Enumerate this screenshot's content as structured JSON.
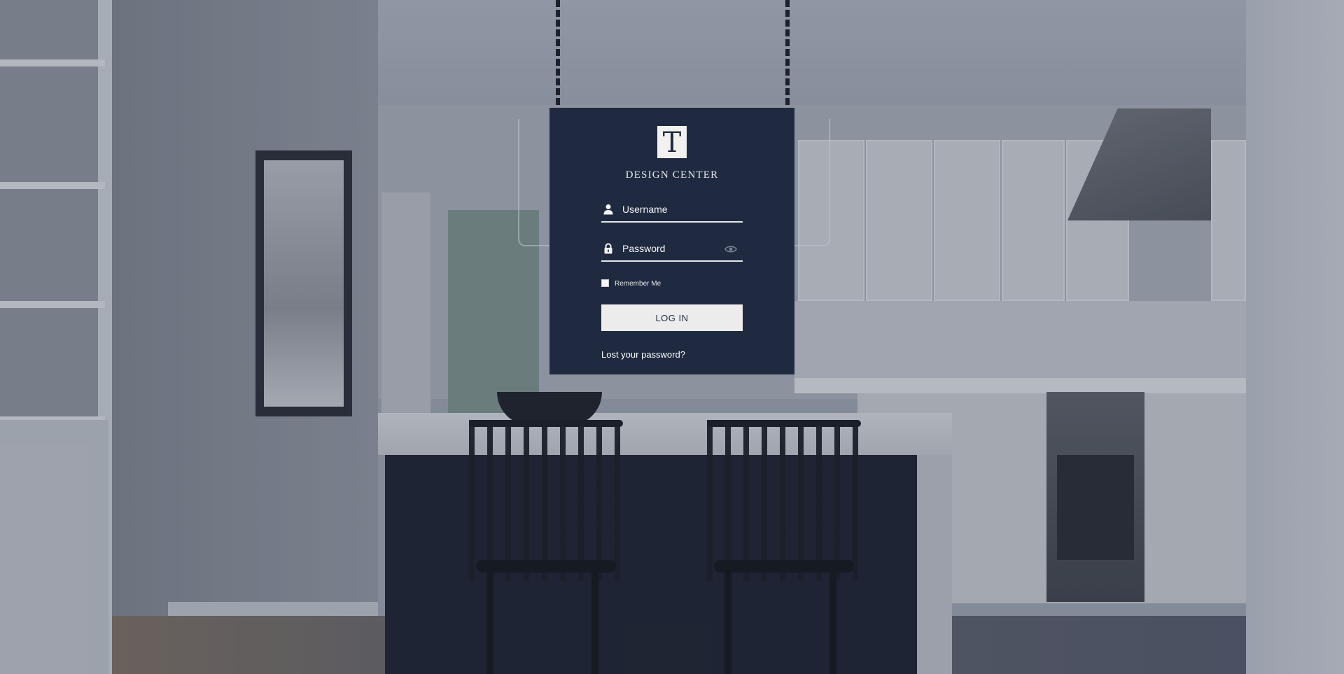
{
  "brand": {
    "logo_letter": "T",
    "name": "DESIGN CENTER"
  },
  "login": {
    "username_placeholder": "Username",
    "password_placeholder": "Password",
    "remember_label": "Remember Me",
    "submit_label": "LOG IN",
    "lost_password_link": "Lost your password?"
  },
  "icons": {
    "username": "user-icon",
    "password": "lock-icon",
    "show_password": "eye-icon"
  },
  "colors": {
    "panel_background": "#1f2a40",
    "button_background": "#ececec",
    "text_light": "#ffffff"
  }
}
